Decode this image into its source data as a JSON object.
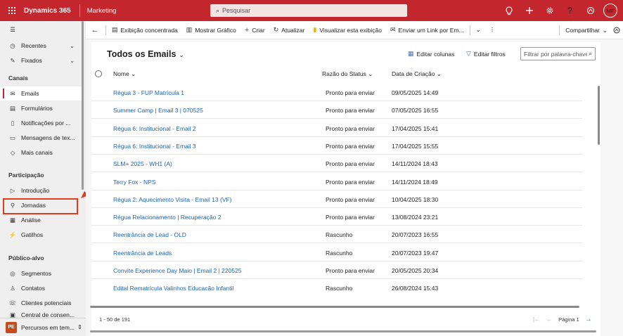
{
  "header": {
    "app_name": "Dynamics 365",
    "area_name": "Marketing",
    "search_placeholder": "Pesquisar",
    "avatar_initials": "MF",
    "icons": [
      "lightbulb-icon",
      "plus-icon",
      "gear-icon",
      "help-icon",
      "copilot-icon"
    ]
  },
  "sidebar": {
    "top_items": [
      {
        "label": "Recentes",
        "icon": "clock-icon"
      },
      {
        "label": "Fixados",
        "icon": "pin-icon"
      }
    ],
    "sections": [
      {
        "title": "Canais",
        "items": [
          "Emails",
          "Formulários",
          "Notificações por ...",
          "Mensagens de tex...",
          "Mais canais"
        ]
      },
      {
        "title": "Participação",
        "items": [
          "Introdução",
          "Jornadas",
          "Análise",
          "Gatilhos"
        ]
      },
      {
        "title": "Público-alvo",
        "items": [
          "Segmentos",
          "Contatos",
          "Clientes potenciais",
          "Central de consen..."
        ]
      }
    ],
    "active_item": "Emails",
    "highlighted_item": "Jornadas",
    "area_switcher": {
      "badge": "PE",
      "label": "Percursos em tem..."
    }
  },
  "commandbar": {
    "items": [
      "Exibição concentrada",
      "Mostrar Gráfico",
      "Criar",
      "Atualizar",
      "Visualizar esta exibição",
      "Enviar um Link por Em..."
    ],
    "share_label": "Compartilhar"
  },
  "view": {
    "title": "Todos os Emails",
    "edit_columns": "Editar colunas",
    "edit_filters": "Editar filtros",
    "filter_placeholder": "Filtrar por palavra-chave",
    "columns": [
      "Nome",
      "Razão do Status",
      "Data de Criação"
    ]
  },
  "rows": [
    [
      "Régua 3 - FUP Matrícula 1",
      "Pronto para enviar",
      "09/05/2025 14:49"
    ],
    [
      "Summer Camp | Email 3 | 070525",
      "Pronto para enviar",
      "07/05/2025 16:55"
    ],
    [
      "Régua 6: Institucional - Email 2",
      "Pronto para enviar",
      "17/04/2025 15:41"
    ],
    [
      "Régua 6: Institucional - Email 3",
      "Pronto para enviar",
      "17/04/2025 15:55"
    ],
    [
      "SLM+ 2025 - WH1 (A)",
      "Pronto para enviar",
      "14/11/2024 18:43"
    ],
    [
      "Terry Fox - NPS",
      "Pronto para enviar",
      "14/11/2024 18:49"
    ],
    [
      "Régua 2: Aquecimento Visita - Email 13 (VF)",
      "Pronto para enviar",
      "10/04/2025 18:30"
    ],
    [
      "Régua Relacionamento | Recuperação 2",
      "Pronto para enviar",
      "13/08/2024 23:21"
    ],
    [
      "Reentrância de Lead - OLD",
      "Rascunho",
      "20/07/2023 16:55"
    ],
    [
      "Reentrância de Leads",
      "Rascunho",
      "20/07/2023 19:47"
    ],
    [
      "Convite Experience Day Maio | Email 2 | 220525",
      "Pronto para enviar",
      "20/05/2025 20:34"
    ],
    [
      "Edital Rematrícula Valinhos Educação Infantil",
      "Rascunho",
      "26/08/2024 15:43"
    ]
  ],
  "footer": {
    "count": "1 - 50 de 191",
    "page_label": "Página 1"
  }
}
